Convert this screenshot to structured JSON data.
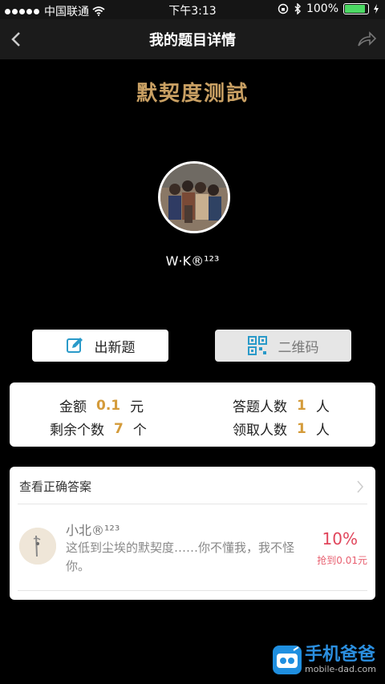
{
  "status_bar": {
    "carrier": "中国联通",
    "time": "下午3:13",
    "battery": "100%"
  },
  "nav": {
    "title": "我的题目详情"
  },
  "quiz": {
    "title": "默契度测試",
    "username": "W·K®¹²³"
  },
  "buttons": {
    "new_question": "出新题",
    "qr_code": "二维码"
  },
  "stats": {
    "amount_label": "金额",
    "amount_value": "0.1",
    "amount_unit": "元",
    "answerers_label": "答题人数",
    "answerers_value": "1",
    "answerers_unit": "人",
    "remaining_label": "剩余个数",
    "remaining_value": "7",
    "remaining_unit": "个",
    "claimed_label": "领取人数",
    "claimed_value": "1",
    "claimed_unit": "人"
  },
  "answers": {
    "header": "查看正确答案",
    "items": [
      {
        "name": "小北®¹²³",
        "comment": "这低到尘埃的默契度……你不懂我，我不怪你。",
        "percent": "10%",
        "grabbed": "抢到0.01元"
      }
    ]
  },
  "watermark": {
    "main": "手机爸爸",
    "sub": "mobile-dad.com"
  },
  "colors": {
    "accent_gold": "#c9a063",
    "number_gold": "#d49b3a",
    "percent_red": "#e0455b"
  }
}
